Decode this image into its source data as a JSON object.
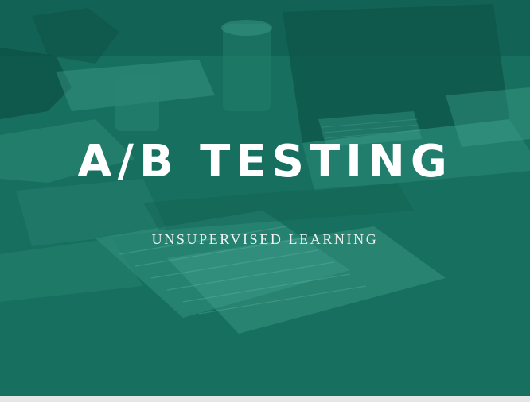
{
  "slide": {
    "title": "A/B TESTING",
    "subtitle": "UNSUPERVISED LEARNING",
    "background_color": "#17705f",
    "text_color": "#ffffff"
  }
}
